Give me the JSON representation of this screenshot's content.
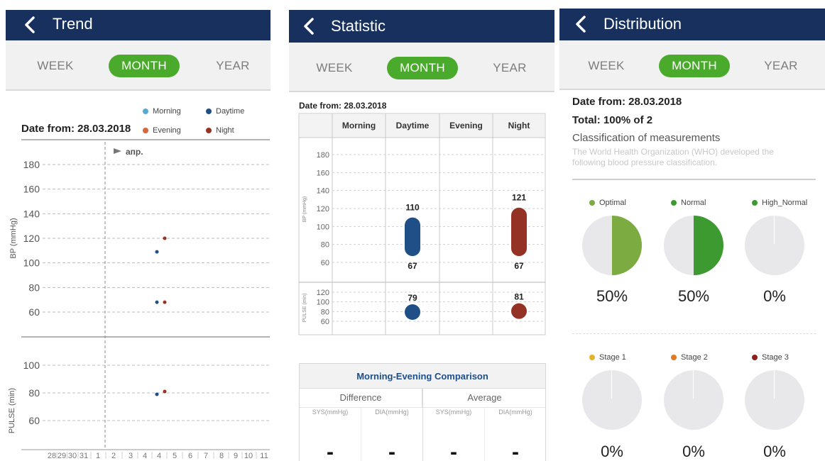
{
  "colors": {
    "header": "#17305e",
    "accent_green": "#4aaa2c",
    "morning": "#58a8d6",
    "daytime": "#1f4f86",
    "evening": "#d9653a",
    "night": "#943226",
    "optimal": "#7bab41",
    "normal": "#3d9a30",
    "high_normal": "#3d9a30",
    "stage1": "#e4b22a",
    "stage2": "#e07a27",
    "stage3": "#8f1f1f"
  },
  "periods": [
    "WEEK",
    "MONTH",
    "YEAR"
  ],
  "active_period": "MONTH",
  "trend": {
    "title": "Trend",
    "date_from": "Date from: 28.03.2018",
    "legend": [
      "Morning",
      "Daytime",
      "Evening",
      "Night"
    ],
    "month_marker": "апр.",
    "bp_label": "BP (mmHg)",
    "pulse_label": "PULSE (min)",
    "bp_ticks": [
      "180",
      "160",
      "140",
      "120",
      "100",
      "80",
      "60"
    ],
    "pulse_ticks": [
      "100",
      "80",
      "60"
    ],
    "x_days": [
      "28",
      "29",
      "30",
      "31",
      "1",
      "2",
      "3",
      "4",
      "4",
      "5",
      "6",
      "7",
      "8",
      "9",
      "10",
      "11"
    ],
    "chart_data": {
      "type": "scatter",
      "x": [
        "28",
        "29",
        "30",
        "31",
        "1",
        "2",
        "3",
        "4",
        "5",
        "6",
        "7",
        "8",
        "9",
        "10",
        "11"
      ],
      "bp": {
        "ylim": [
          50,
          190
        ],
        "series": [
          {
            "name": "Daytime",
            "points": [
              {
                "x": "4",
                "y": 109
              },
              {
                "x": "4",
                "y": 68
              }
            ]
          },
          {
            "name": "Night",
            "points": [
              {
                "x": "4",
                "y": 120
              },
              {
                "x": "4",
                "y": 68
              }
            ]
          }
        ]
      },
      "pulse": {
        "ylim": [
          50,
          110
        ],
        "series": [
          {
            "name": "Daytime",
            "points": [
              {
                "x": "4",
                "y": 79
              }
            ]
          },
          {
            "name": "Night",
            "points": [
              {
                "x": "4",
                "y": 81
              }
            ]
          }
        ]
      }
    }
  },
  "statistic": {
    "title": "Statistic",
    "date_from": "Date from: 28.03.2018",
    "columns": [
      "Morning",
      "Daytime",
      "Evening",
      "Night"
    ],
    "bp_label": "BP (mmHg)",
    "pulse_label": "PULSE (min)",
    "bp_ticks": [
      "180",
      "160",
      "140",
      "120",
      "100",
      "80",
      "60"
    ],
    "pulse_ticks": [
      "120",
      "100",
      "80",
      "60"
    ],
    "chart_data": {
      "type": "range",
      "bp_ylim": [
        50,
        190
      ],
      "pulse_ylim": [
        50,
        125
      ],
      "bp": [
        {
          "name": "Daytime",
          "high": 110,
          "low": 67
        },
        {
          "name": "Night",
          "high": 121,
          "low": 67
        }
      ],
      "pulse": [
        {
          "name": "Daytime",
          "value": 79
        },
        {
          "name": "Night",
          "value": 81
        }
      ]
    },
    "comparison": {
      "title": "Morning-Evening Comparison",
      "difference": "Difference",
      "average": "Average",
      "cols": [
        "SYS(mmHg)",
        "DIA(mmHg)",
        "SYS(mmHg)",
        "DIA(mmHg)"
      ],
      "values": [
        "-",
        "-",
        "-",
        "-"
      ]
    }
  },
  "distribution": {
    "title": "Distribution",
    "date_from": "Date from: 28.03.2018",
    "total": "Total: 100% of 2",
    "heading": "Classification of measurements",
    "description": "The World Health Organization (WHO) developed the following blood pressure classification.",
    "chart_data": {
      "type": "pie",
      "categories": [
        "Optimal",
        "Normal",
        "High_Normal",
        "Stage 1",
        "Stage 2",
        "Stage 3"
      ],
      "values": [
        50,
        50,
        0,
        0,
        0,
        0
      ]
    },
    "items": [
      {
        "label": "Optimal",
        "pct": "50%"
      },
      {
        "label": "Normal",
        "pct": "50%"
      },
      {
        "label": "High_Normal",
        "pct": "0%"
      },
      {
        "label": "Stage 1",
        "pct": "0%"
      },
      {
        "label": "Stage 2",
        "pct": "0%"
      },
      {
        "label": "Stage 3",
        "pct": "0%"
      }
    ]
  }
}
